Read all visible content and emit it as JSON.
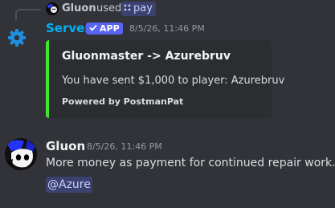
{
  "reply": {
    "username": "Gluon",
    "used_text": "used",
    "command": "pay",
    "command_icon": "slash-command-icon"
  },
  "bot_message": {
    "author": "Server",
    "badge": "APP",
    "badge_icon": "checkmark-icon",
    "timestamp": "8/5/26, 11:46 PM",
    "avatar_icon": "gear-icon",
    "embed": {
      "title": "Gluonmaster -> Azurebruv",
      "description": "You have sent $1,000 to player: Azurebruv",
      "footer": "Powered by PostmanPat",
      "accent_color": "#43e62d"
    }
  },
  "user_message": {
    "author": "Gluon",
    "timestamp": "8/5/26, 11:46 PM",
    "text": "More money as payment for continued repair work.",
    "mention": "@Azure"
  },
  "colors": {
    "background": "#313338",
    "bot_name": "#00b0f4",
    "badge": "#5865f2",
    "mention_bg": "#3c4270",
    "mention_text": "#c9cdfb"
  }
}
